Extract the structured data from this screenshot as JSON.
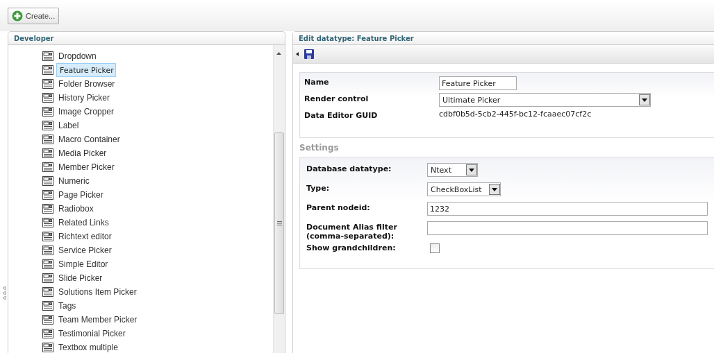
{
  "toolbar": {
    "create_button": "Create..."
  },
  "tree": {
    "title": "Developer",
    "items": [
      {
        "label": "Dropdown",
        "selected": false
      },
      {
        "label": "Feature Picker",
        "selected": true
      },
      {
        "label": "Folder Browser",
        "selected": false
      },
      {
        "label": "History Picker",
        "selected": false
      },
      {
        "label": "Image Cropper",
        "selected": false
      },
      {
        "label": "Label",
        "selected": false
      },
      {
        "label": "Macro Container",
        "selected": false
      },
      {
        "label": "Media Picker",
        "selected": false
      },
      {
        "label": "Member Picker",
        "selected": false
      },
      {
        "label": "Numeric",
        "selected": false
      },
      {
        "label": "Page Picker",
        "selected": false
      },
      {
        "label": "Radiobox",
        "selected": false
      },
      {
        "label": "Related Links",
        "selected": false
      },
      {
        "label": "Richtext editor",
        "selected": false
      },
      {
        "label": "Service Picker",
        "selected": false
      },
      {
        "label": "Simple Editor",
        "selected": false
      },
      {
        "label": "Slide Picker",
        "selected": false
      },
      {
        "label": "Solutions Item Picker",
        "selected": false
      },
      {
        "label": "Tags",
        "selected": false
      },
      {
        "label": "Team Member Picker",
        "selected": false
      },
      {
        "label": "Testimonial Picker",
        "selected": false
      },
      {
        "label": "Textbox multiple",
        "selected": false
      }
    ]
  },
  "editor": {
    "title": "Edit datatype: Feature Picker",
    "properties": [
      {
        "kind": "text",
        "label": "Name",
        "value": "Feature Picker"
      },
      {
        "kind": "select",
        "label": "Render control",
        "value": "Ultimate Picker"
      },
      {
        "kind": "static",
        "label": "Data Editor GUID",
        "value": "cdbf0b5d-5cb2-445f-bc12-fcaaec07cf2c"
      }
    ],
    "settings_title": "Settings",
    "settings": [
      {
        "kind": "select-small",
        "label": "Database datatype:",
        "value": "Ntext"
      },
      {
        "kind": "select-medium",
        "label": "Type:",
        "value": "CheckBoxList"
      },
      {
        "kind": "wide-text",
        "label": "Parent nodeid:",
        "value": "1232"
      },
      {
        "kind": "wide-text",
        "label": "Document Alias filter (comma-separated):"
      },
      {
        "kind": "checkbox",
        "label": "Show grandchildren:",
        "checked": false
      }
    ]
  }
}
